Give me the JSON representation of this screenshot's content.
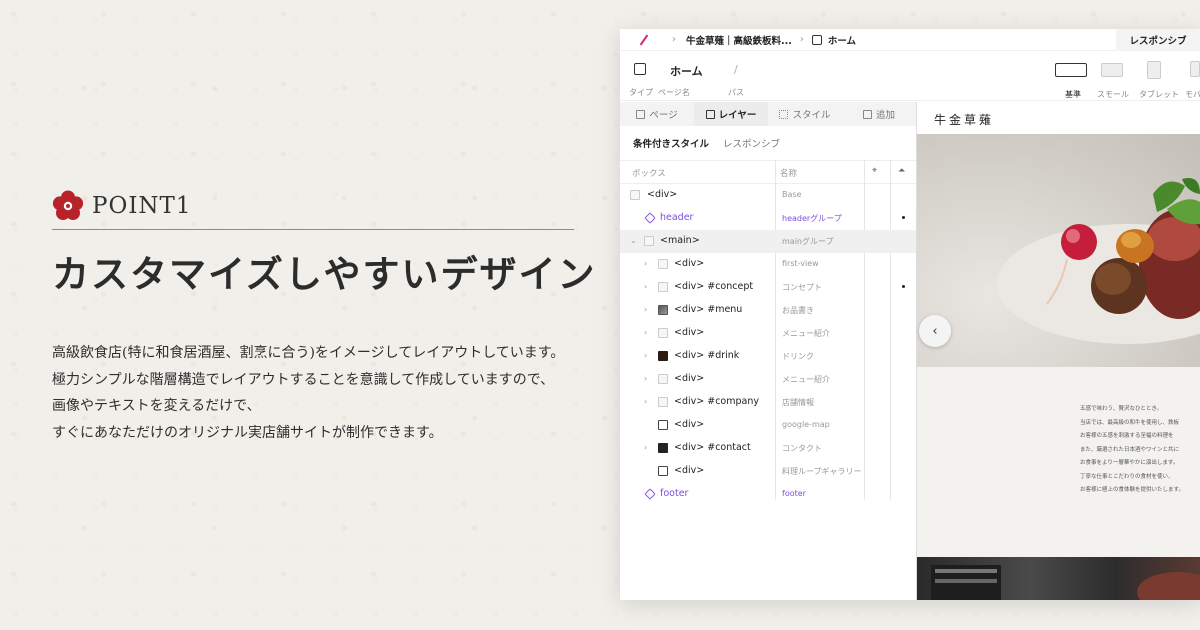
{
  "left": {
    "point_label": "POINT1",
    "headline": "カスタマイズしやすいデザイン",
    "description": [
      "高級飲食店(特に和食居酒屋、割烹に合う)をイメージしてレイアウトしています。",
      "極力シンプルな階層構造でレイアウトすることを意識して作成していますので、",
      "画像やテキストを変えるだけで、",
      "すぐにあなただけのオリジナル実店舗サイトが制作できます。"
    ]
  },
  "topbar": {
    "breadcrumb_site": "牛金草薙｜高級鉄板料...",
    "breadcrumb_page": "ホーム",
    "responsive_tab": "レスポンシブ"
  },
  "pagebar": {
    "page_name": "ホーム",
    "path": "/",
    "labels": {
      "type": "タイプ",
      "page_name": "ページ名",
      "path": "パス"
    },
    "devices": [
      "基準",
      "スモール",
      "タブレット",
      "モバ"
    ]
  },
  "panel": {
    "tabs": [
      "ページ",
      "レイヤー",
      "スタイル",
      "追加"
    ],
    "active_tab": "レイヤー",
    "subtabs": [
      "条件付きスタイル",
      "レスポンシブ"
    ],
    "columns": {
      "box": "ボックス",
      "name": "名称"
    },
    "rows": [
      {
        "label": "<div>",
        "name": "Base"
      },
      {
        "label": "header",
        "name": "headerグループ"
      },
      {
        "label": "<main>",
        "name": "mainグループ"
      },
      {
        "label": "<div>",
        "name": "first-view"
      },
      {
        "label": "<div> #concept",
        "name": "コンセプト"
      },
      {
        "label": "<div> #menu",
        "name": "お品書き"
      },
      {
        "label": "<div>",
        "name": "メニュー紹介"
      },
      {
        "label": "<div> #drink",
        "name": "ドリンク"
      },
      {
        "label": "<div>",
        "name": "メニュー紹介"
      },
      {
        "label": "<div> #company",
        "name": "店舗情報"
      },
      {
        "label": "<div>",
        "name": "google-map"
      },
      {
        "label": "<div> #contact",
        "name": "コンタクト"
      },
      {
        "label": "<div>",
        "name": "料理ループギャラリー"
      },
      {
        "label": "footer",
        "name": "footer"
      }
    ]
  },
  "preview": {
    "logo": "牛金草薙",
    "prev_arrow": "‹",
    "concept_lines": [
      "五感で味わう、贅沢なひととき。",
      "当店では、最高級の和牛を使用し、鉄板",
      "お客様の五感を刺激する至福の料理を",
      "また、厳選された日本酒やワインと共に",
      "お食事をより一層華やかに演出します。",
      "丁寧な仕事とこだわりの食材を使い、",
      "お客様に極上の食体験を提供いたします。"
    ]
  },
  "colors": {
    "accent": "#d0237a",
    "plum": "#b8232a",
    "purple": "#7a4ee0"
  }
}
